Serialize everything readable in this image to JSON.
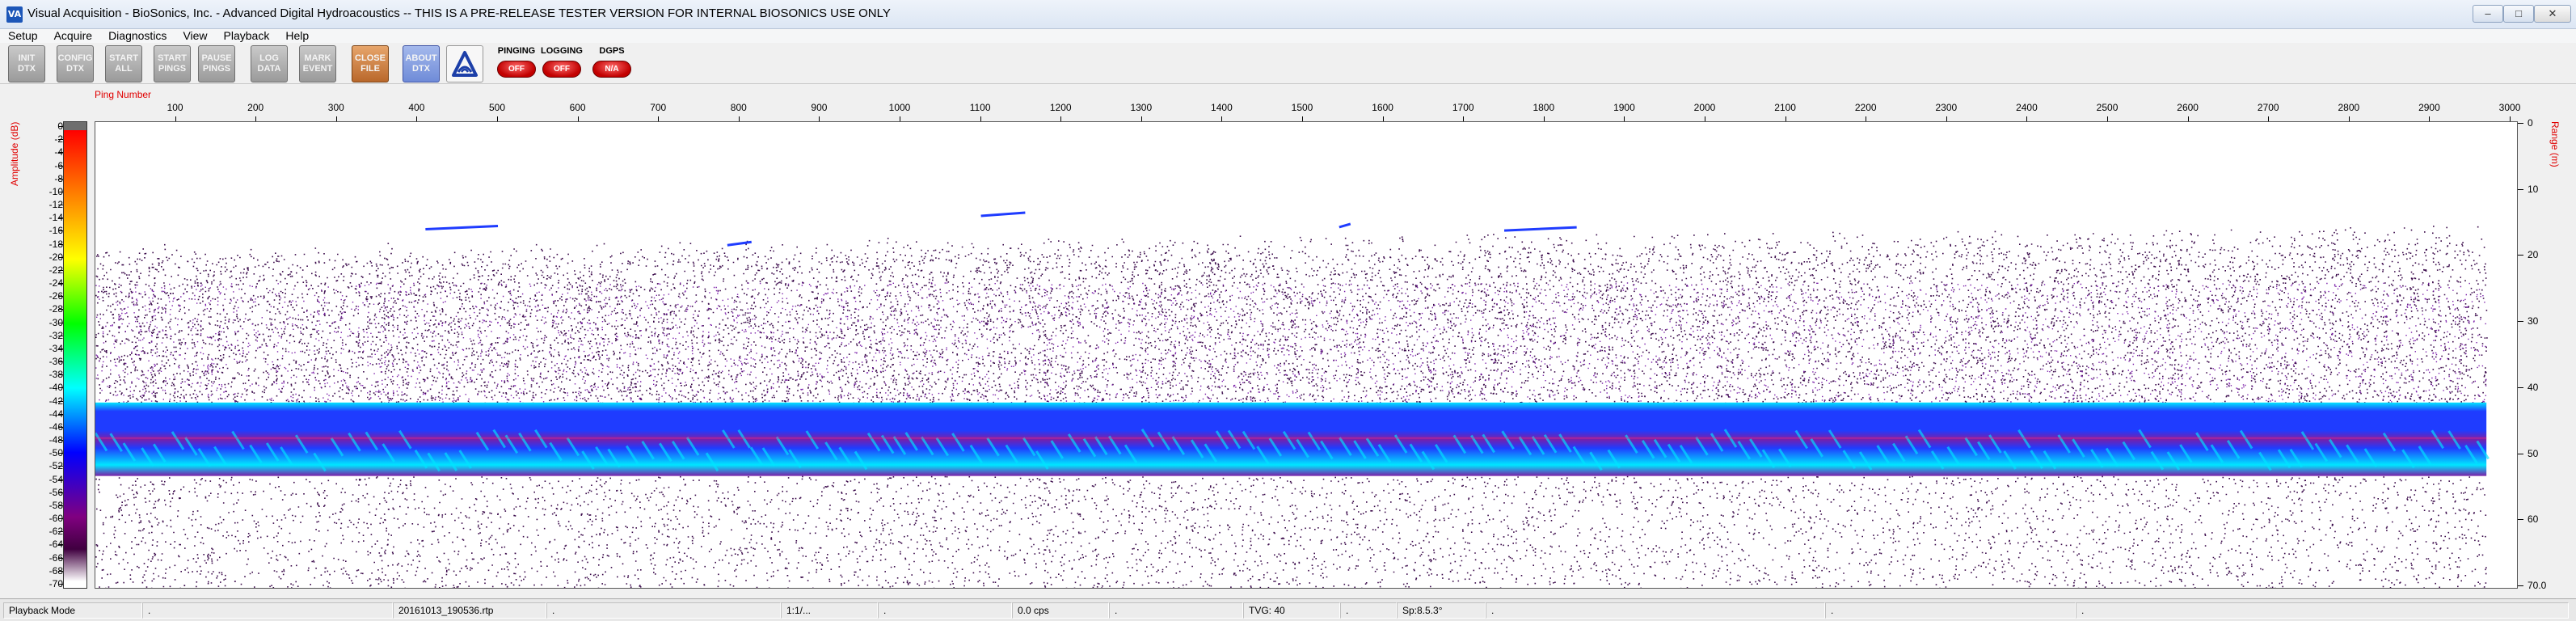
{
  "window": {
    "title": "Visual Acquisition  -  BioSonics, Inc.  -  Advanced Digital Hydroacoustics  --  THIS IS A PRE-RELEASE TESTER VERSION FOR INTERNAL BIOSONICS USE ONLY",
    "app_icon": "VA"
  },
  "menu": [
    "Setup",
    "Acquire",
    "Diagnostics",
    "View",
    "Playback",
    "Help"
  ],
  "toolbar": {
    "buttons": [
      {
        "label": "INIT\nDTX",
        "style": "gray"
      },
      {
        "label": "CONFIG\nDTX",
        "style": "gray"
      },
      {
        "label": "START\nALL",
        "style": "gray"
      },
      {
        "label": "START\nPINGS",
        "style": "gray"
      },
      {
        "label": "PAUSE\nPINGS",
        "style": "gray"
      },
      {
        "label": "LOG\nDATA",
        "style": "gray"
      },
      {
        "label": "MARK\nEVENT",
        "style": "gray"
      },
      {
        "label": "CLOSE\nFILE",
        "style": "orange"
      },
      {
        "label": "ABOUT\nDTX",
        "style": "blue"
      }
    ],
    "logo_icon": "biosonics-logo-icon",
    "status": [
      {
        "title": "PINGING",
        "value": "OFF"
      },
      {
        "title": "LOGGING",
        "value": "OFF"
      },
      {
        "title": "DGPS",
        "value": "N/A"
      }
    ]
  },
  "colorbar": {
    "label": "Amplitude (dB)",
    "ticks": [
      "0",
      "-2",
      "-4",
      "-6",
      "-8",
      "-10",
      "-12",
      "-14",
      "-16",
      "-18",
      "-20",
      "-22",
      "-24",
      "-26",
      "-28",
      "-30",
      "-32",
      "-34",
      "-36",
      "-38",
      "-40",
      "-42",
      "-44",
      "-46",
      "-48",
      "-50",
      "-52",
      "-54",
      "-56",
      "-58",
      "-60",
      "-62",
      "-64",
      "-66",
      "-68",
      "-70"
    ],
    "colors": [
      "#6e6e6e",
      "#ff0000",
      "#ff4000",
      "#ff8000",
      "#ffbf00",
      "#ffff00",
      "#80ff00",
      "#00ff00",
      "#00ff80",
      "#00ffff",
      "#0080ff",
      "#0000ff",
      "#4000c0",
      "#800080",
      "#400040",
      "#ffffff"
    ]
  },
  "echogram": {
    "x_label": "Ping Number",
    "x_ticks": [
      "100",
      "200",
      "300",
      "400",
      "500",
      "600",
      "700",
      "800",
      "900",
      "1000",
      "1100",
      "1200",
      "1300",
      "1400",
      "1500",
      "1600",
      "1700",
      "1800",
      "1900",
      "2000",
      "2100",
      "2200",
      "2300",
      "2400",
      "2500",
      "2600",
      "2700",
      "2800",
      "2900",
      "3000"
    ],
    "x_tick_values": [
      100,
      200,
      300,
      400,
      500,
      600,
      700,
      800,
      900,
      1000,
      1100,
      1200,
      1300,
      1400,
      1500,
      1600,
      1700,
      1800,
      1900,
      2000,
      2100,
      2200,
      2300,
      2400,
      2500,
      2600,
      2700,
      2800,
      2900,
      3000
    ],
    "x_range": [
      0,
      3010
    ],
    "range_label": "Range (m)",
    "range_ticks": [
      "0",
      "10",
      "20",
      "30",
      "40",
      "50",
      "60",
      "70.0"
    ],
    "range_tick_values": [
      0,
      10,
      20,
      30,
      40,
      50,
      60,
      70
    ],
    "range_max": 70,
    "data_pings": 2970,
    "bottom_band_range_m": [
      42,
      53
    ],
    "colors": {
      "strong": "#00e5ff",
      "mid": "#1f3cff",
      "weak": "#7a1fa8",
      "noise": "#3a0a4a",
      "hot": "#ff2a7a"
    }
  },
  "statusbar": [
    "Playback Mode",
    ".",
    "20161013_190536.rtp",
    ".",
    "1:1/...",
    ".",
    "0.0 cps",
    ".",
    "TVG: 40",
    ".",
    "Sp:8.5.3°",
    ".",
    ".",
    "."
  ]
}
